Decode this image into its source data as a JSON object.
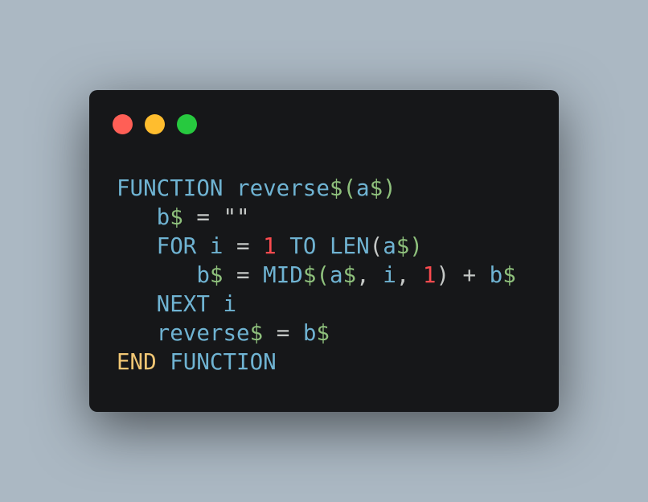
{
  "colors": {
    "background": "#abb8c3",
    "window": "#161719",
    "close": "#ff5f56",
    "minimize": "#ffbd2e",
    "maximize": "#27c93f",
    "keyword": "#6fb3d2",
    "identifier": "#6fb3d2",
    "sigil": "#8ec07c",
    "operator": "#c5c8c6",
    "number": "#fc4b4f",
    "end_keyword": "#f0c674"
  },
  "window_controls": [
    {
      "name": "close-button",
      "color": "#ff5f56"
    },
    {
      "name": "minimize-button",
      "color": "#ffbd2e"
    },
    {
      "name": "maximize-button",
      "color": "#27c93f"
    }
  ],
  "code": {
    "language": "basic",
    "lines": [
      [
        {
          "t": "FUNCTION",
          "c": "#6fb3d2"
        },
        {
          "t": " ",
          "c": "#c5c8c6"
        },
        {
          "t": "reverse",
          "c": "#6fb3d2"
        },
        {
          "t": "$(",
          "c": "#8ec07c"
        },
        {
          "t": "a",
          "c": "#6fb3d2"
        },
        {
          "t": "$)",
          "c": "#8ec07c"
        }
      ],
      [
        {
          "t": "   ",
          "c": "#c5c8c6"
        },
        {
          "t": "b",
          "c": "#6fb3d2"
        },
        {
          "t": "$",
          "c": "#8ec07c"
        },
        {
          "t": " = ",
          "c": "#c5c8c6"
        },
        {
          "t": "\"\"",
          "c": "#c5c8c6"
        }
      ],
      [
        {
          "t": "   ",
          "c": "#c5c8c6"
        },
        {
          "t": "FOR",
          "c": "#6fb3d2"
        },
        {
          "t": " ",
          "c": "#c5c8c6"
        },
        {
          "t": "i",
          "c": "#6fb3d2"
        },
        {
          "t": " = ",
          "c": "#c5c8c6"
        },
        {
          "t": "1",
          "c": "#fc4b4f"
        },
        {
          "t": " ",
          "c": "#c5c8c6"
        },
        {
          "t": "TO",
          "c": "#6fb3d2"
        },
        {
          "t": " ",
          "c": "#c5c8c6"
        },
        {
          "t": "LEN",
          "c": "#6fb3d2"
        },
        {
          "t": "(",
          "c": "#c5c8c6"
        },
        {
          "t": "a",
          "c": "#6fb3d2"
        },
        {
          "t": "$)",
          "c": "#8ec07c"
        }
      ],
      [
        {
          "t": "      ",
          "c": "#c5c8c6"
        },
        {
          "t": "b",
          "c": "#6fb3d2"
        },
        {
          "t": "$",
          "c": "#8ec07c"
        },
        {
          "t": " = ",
          "c": "#c5c8c6"
        },
        {
          "t": "MID",
          "c": "#6fb3d2"
        },
        {
          "t": "$(",
          "c": "#8ec07c"
        },
        {
          "t": "a",
          "c": "#6fb3d2"
        },
        {
          "t": "$",
          "c": "#8ec07c"
        },
        {
          "t": ", ",
          "c": "#c5c8c6"
        },
        {
          "t": "i",
          "c": "#6fb3d2"
        },
        {
          "t": ", ",
          "c": "#c5c8c6"
        },
        {
          "t": "1",
          "c": "#fc4b4f"
        },
        {
          "t": ") + ",
          "c": "#c5c8c6"
        },
        {
          "t": "b",
          "c": "#6fb3d2"
        },
        {
          "t": "$",
          "c": "#8ec07c"
        }
      ],
      [
        {
          "t": "   ",
          "c": "#c5c8c6"
        },
        {
          "t": "NEXT",
          "c": "#6fb3d2"
        },
        {
          "t": " ",
          "c": "#c5c8c6"
        },
        {
          "t": "i",
          "c": "#6fb3d2"
        }
      ],
      [
        {
          "t": "   ",
          "c": "#c5c8c6"
        },
        {
          "t": "reverse",
          "c": "#6fb3d2"
        },
        {
          "t": "$",
          "c": "#8ec07c"
        },
        {
          "t": " = ",
          "c": "#c5c8c6"
        },
        {
          "t": "b",
          "c": "#6fb3d2"
        },
        {
          "t": "$",
          "c": "#8ec07c"
        }
      ],
      [
        {
          "t": "END",
          "c": "#f0c674"
        },
        {
          "t": " ",
          "c": "#c5c8c6"
        },
        {
          "t": "FUNCTION",
          "c": "#6fb3d2"
        }
      ]
    ]
  }
}
